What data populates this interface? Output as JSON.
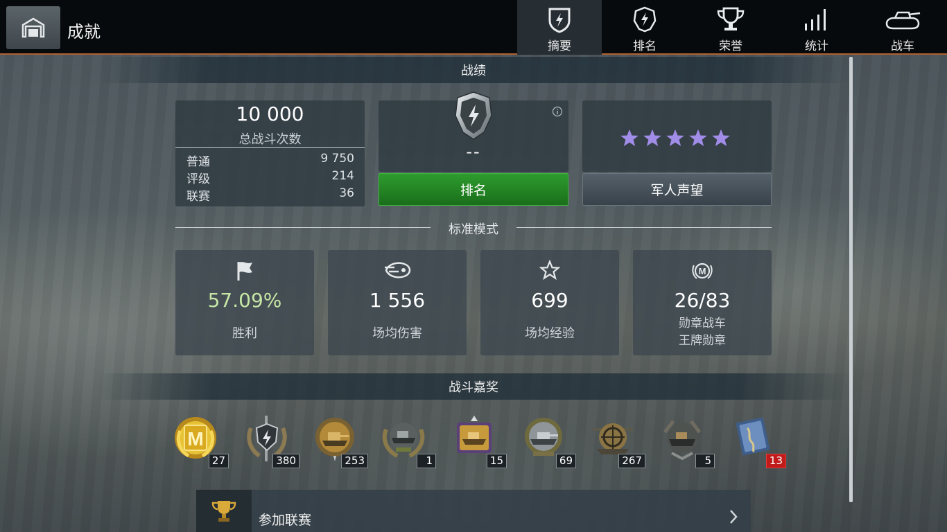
{
  "header": {
    "title": "成就",
    "tabs": [
      {
        "label": "摘要",
        "icon": "shield-bolt-icon",
        "active": true
      },
      {
        "label": "排名",
        "icon": "rank-badge-icon",
        "active": false
      },
      {
        "label": "荣誉",
        "icon": "trophy-icon",
        "active": false
      },
      {
        "label": "统计",
        "icon": "bar-stats-icon",
        "active": false
      },
      {
        "label": "战车",
        "icon": "tank-icon",
        "active": false
      }
    ]
  },
  "record": {
    "section_title": "战绩",
    "total_battles": "10 000",
    "total_battles_label": "总战斗次数",
    "breakdown": [
      {
        "label": "普通",
        "value": "9 750"
      },
      {
        "label": "评级",
        "value": "214"
      },
      {
        "label": "联赛",
        "value": "36"
      }
    ],
    "rank_value": "--",
    "rank_button": "排名",
    "reputation_stars": 5,
    "reputation_button": "军人声望"
  },
  "standard_mode": {
    "title": "标准模式",
    "stats": [
      {
        "value": "57.09%",
        "label": "胜利",
        "icon": "flag-icon",
        "value_color": "#c6e6a6"
      },
      {
        "value": "1 556",
        "label": "场均伤害",
        "icon": "shell-icon"
      },
      {
        "value": "699",
        "label": "场均经验",
        "icon": "star-icon"
      },
      {
        "value": "26/83",
        "label": "勋章战车",
        "label2": "王牌勋章",
        "icon": "mastery-badge-icon"
      }
    ]
  },
  "awards": {
    "section_title": "战斗嘉奖",
    "medals": [
      {
        "icon": "mastery-m-medal-icon",
        "count": "27"
      },
      {
        "icon": "sword-shield-medal-icon",
        "count": "380"
      },
      {
        "icon": "tank-gold-medal-icon",
        "count": "253"
      },
      {
        "icon": "tank-laurel-medal-icon",
        "count": "1"
      },
      {
        "icon": "tank-purple-medal-icon",
        "count": "15"
      },
      {
        "icon": "tank-grey-medal-icon",
        "count": "69"
      },
      {
        "icon": "crosshair-medal-icon",
        "count": "267"
      },
      {
        "icon": "tank-dark-medal-icon",
        "count": "5"
      },
      {
        "icon": "blueprint-medal-icon",
        "count": "13"
      }
    ]
  },
  "tournament": {
    "label": "参加联赛",
    "icon": "trophy-icon"
  }
}
